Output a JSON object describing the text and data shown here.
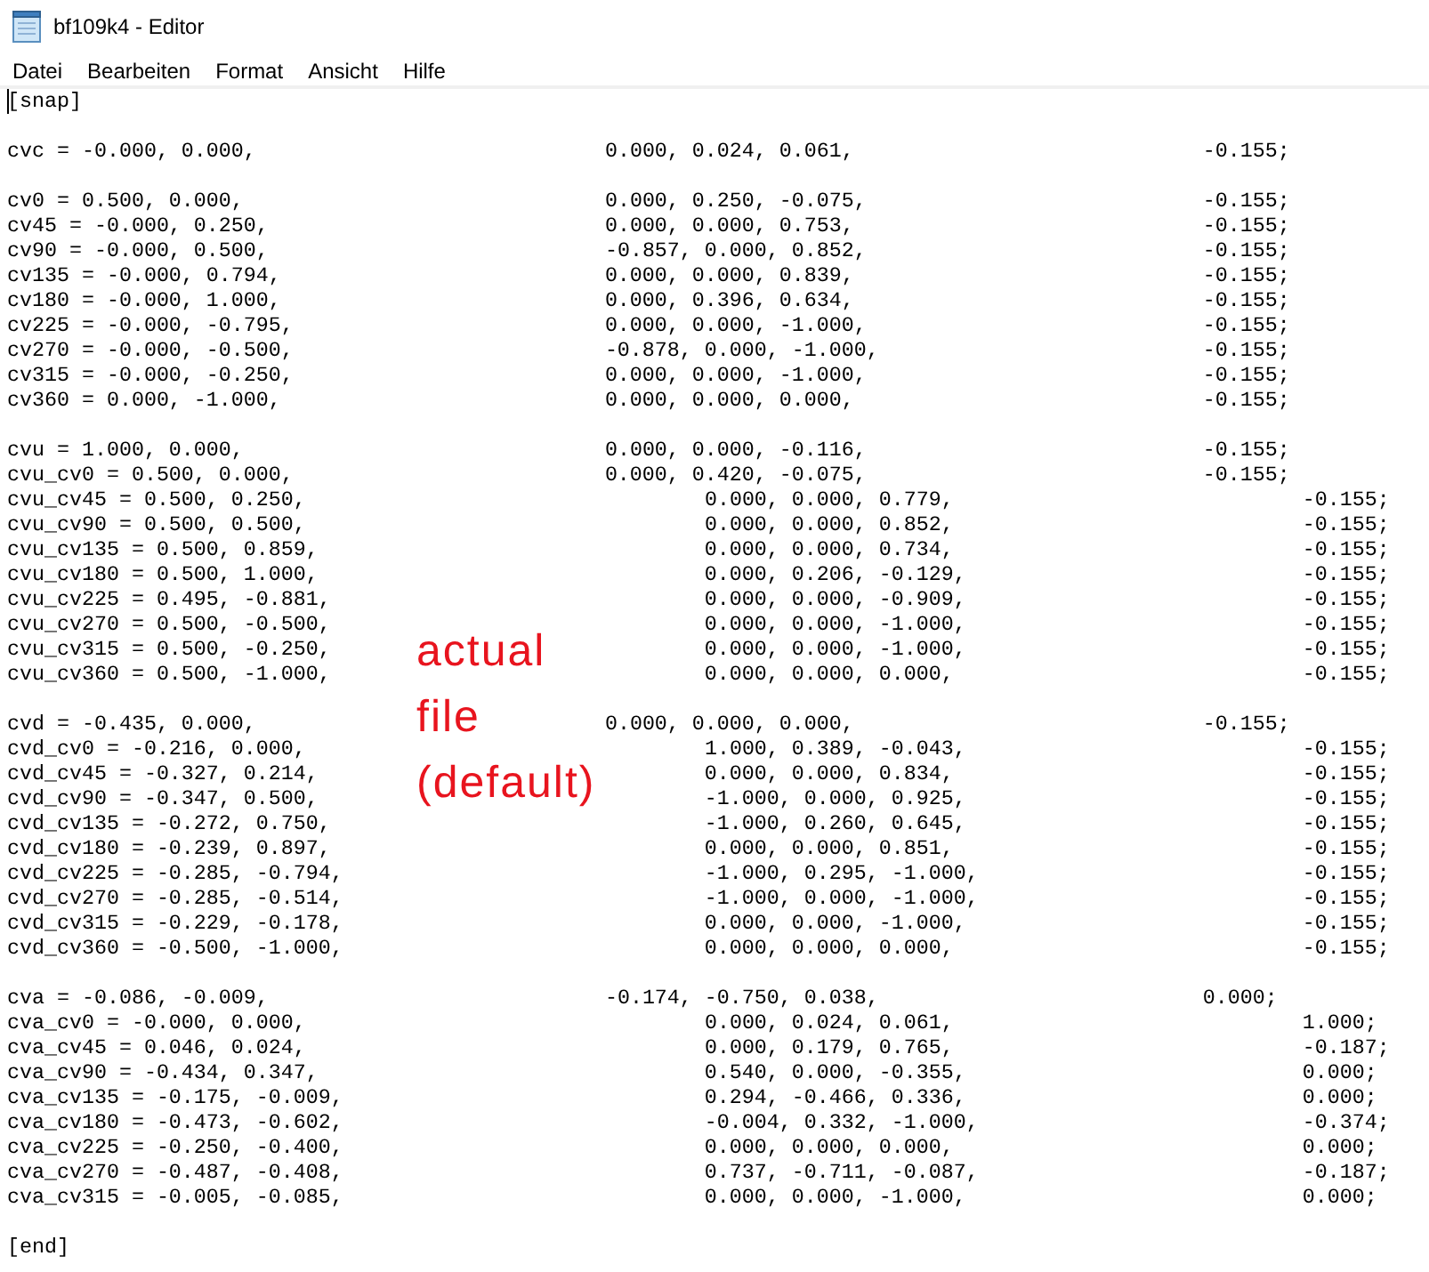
{
  "window": {
    "title": "bf109k4 - Editor"
  },
  "menu": [
    "Datei",
    "Bearbeiten",
    "Format",
    "Ansicht",
    "Hilfe"
  ],
  "editor": {
    "caret_at_start": true,
    "sections": [
      {
        "lines": [
          [
            "[snap]"
          ]
        ]
      },
      {
        "lines": [
          [
            "cvc = -0.000, 0.000,",
            "0.000, 0.024, 0.061,",
            "-0.155;"
          ]
        ]
      },
      {
        "lines": [
          [
            "cv0 = 0.500, 0.000,",
            "0.000, 0.250, -0.075,",
            "-0.155;"
          ],
          [
            "cv45 = -0.000, 0.250,",
            "0.000, 0.000, 0.753,",
            "-0.155;"
          ],
          [
            "cv90 = -0.000, 0.500,",
            "-0.857, 0.000, 0.852,",
            "-0.155;"
          ],
          [
            "cv135 = -0.000, 0.794,",
            "0.000, 0.000, 0.839,",
            "-0.155;"
          ],
          [
            "cv180 = -0.000, 1.000,",
            "0.000, 0.396, 0.634,",
            "-0.155;"
          ],
          [
            "cv225 = -0.000, -0.795,",
            "0.000, 0.000, -1.000,",
            "-0.155;"
          ],
          [
            "cv270 = -0.000, -0.500,",
            "-0.878, 0.000, -1.000,",
            "-0.155;"
          ],
          [
            "cv315 = -0.000, -0.250,",
            "0.000, 0.000, -1.000,",
            "-0.155;"
          ],
          [
            "cv360 = 0.000, -1.000,",
            "0.000, 0.000, 0.000,",
            "-0.155;"
          ]
        ]
      },
      {
        "lines": [
          [
            "cvu = 1.000, 0.000,",
            "0.000, 0.000, -0.116,",
            "-0.155;"
          ],
          [
            "cvu_cv0 = 0.500, 0.000,",
            "0.000, 0.420, -0.075,",
            "-0.155;"
          ],
          [
            "cvu_cv45 = 0.500, 0.250,",
            "0.000, 0.000, 0.779,",
            "-0.155;"
          ],
          [
            "cvu_cv90 = 0.500, 0.500,",
            "0.000, 0.000, 0.852,",
            "-0.155;"
          ],
          [
            "cvu_cv135 = 0.500, 0.859,",
            "0.000, 0.000, 0.734,",
            "-0.155;"
          ],
          [
            "cvu_cv180 = 0.500, 1.000,",
            "0.000, 0.206, -0.129,",
            "-0.155;"
          ],
          [
            "cvu_cv225 = 0.495, -0.881,",
            "0.000, 0.000, -0.909,",
            "-0.155;"
          ],
          [
            "cvu_cv270 = 0.500, -0.500,",
            "0.000, 0.000, -1.000,",
            "-0.155;"
          ],
          [
            "cvu_cv315 = 0.500, -0.250,",
            "0.000, 0.000, -1.000,",
            "-0.155;"
          ],
          [
            "cvu_cv360 = 0.500, -1.000,",
            "0.000, 0.000, 0.000,",
            "-0.155;"
          ]
        ]
      },
      {
        "lines": [
          [
            "cvd = -0.435, 0.000,",
            "0.000, 0.000, 0.000,",
            "-0.155;"
          ],
          [
            "cvd_cv0 = -0.216, 0.000,",
            "1.000, 0.389, -0.043,",
            "-0.155;"
          ],
          [
            "cvd_cv45 = -0.327, 0.214,",
            "0.000, 0.000, 0.834,",
            "-0.155;"
          ],
          [
            "cvd_cv90 = -0.347, 0.500,",
            "-1.000, 0.000, 0.925,",
            "-0.155;"
          ],
          [
            "cvd_cv135 = -0.272, 0.750,",
            "-1.000, 0.260, 0.645,",
            "-0.155;"
          ],
          [
            "cvd_cv180 = -0.239, 0.897,",
            "0.000, 0.000, 0.851,",
            "-0.155;"
          ],
          [
            "cvd_cv225 = -0.285, -0.794,",
            "-1.000, 0.295, -1.000,",
            "-0.155;"
          ],
          [
            "cvd_cv270 = -0.285, -0.514,",
            "-1.000, 0.000, -1.000,",
            "-0.155;"
          ],
          [
            "cvd_cv315 = -0.229, -0.178,",
            "0.000, 0.000, -1.000,",
            "-0.155;"
          ],
          [
            "cvd_cv360 = -0.500, -1.000,",
            "0.000, 0.000, 0.000,",
            "-0.155;"
          ]
        ]
      },
      {
        "lines": [
          [
            "cva = -0.086, -0.009,",
            "-0.174, -0.750, 0.038,",
            "0.000;"
          ],
          [
            "cva_cv0 = -0.000, 0.000,",
            "0.000, 0.024, 0.061,",
            "1.000;"
          ],
          [
            "cva_cv45 = 0.046, 0.024,",
            "0.000, 0.179, 0.765,",
            "-0.187;"
          ],
          [
            "cva_cv90 = -0.434, 0.347,",
            "0.540, 0.000, -0.355,",
            "0.000;"
          ],
          [
            "cva_cv135 = -0.175, -0.009,",
            "0.294, -0.466, 0.336,",
            "0.000;"
          ],
          [
            "cva_cv180 = -0.473, -0.602,",
            "-0.004, 0.332, -1.000,",
            "-0.374;"
          ],
          [
            "cva_cv225 = -0.250, -0.400,",
            "0.000, 0.000, 0.000,",
            "0.000;"
          ],
          [
            "cva_cv270 = -0.487, -0.408,",
            "0.737, -0.711, -0.087,",
            "-0.187;"
          ],
          [
            "cva_cv315 = -0.005, -0.085,",
            "0.000, 0.000, -1.000,",
            "0.000;"
          ]
        ]
      },
      {
        "lines": [
          [
            "[end]"
          ]
        ]
      }
    ]
  },
  "handwritten_note": {
    "lines": [
      "actual",
      "file",
      "(default)"
    ]
  }
}
